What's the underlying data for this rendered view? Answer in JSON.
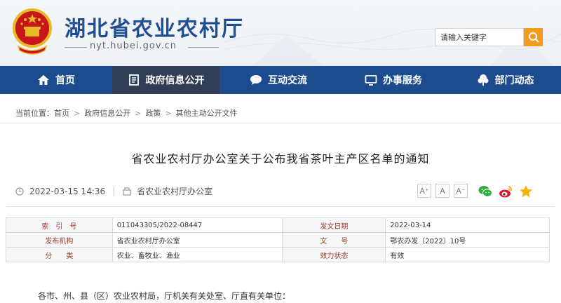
{
  "header": {
    "site_title": "湖北省农业农村厅",
    "site_url": "nyt.hubei.gov.cn",
    "search": {
      "placeholder": "请输入关键字"
    }
  },
  "nav": {
    "items": [
      {
        "label": "首页",
        "icon": "home-icon"
      },
      {
        "label": "政府信息公开",
        "icon": "document-icon",
        "active": true
      },
      {
        "label": "互动交流",
        "icon": "chat-icon"
      },
      {
        "label": "办事服务",
        "icon": "monitor-icon"
      },
      {
        "label": "部门动态",
        "icon": "tree-icon"
      }
    ]
  },
  "breadcrumb": {
    "prefix": "当前位置：",
    "items": [
      "首页",
      "政府信息公开",
      "政策",
      "其他主动公开文件"
    ],
    "separator": ">"
  },
  "article": {
    "title": "省农业农村厅办公室关于公布我省茶叶主产区名单的通知",
    "datetime": "2022-03-15 14:36",
    "source": "省农业农村厅办公室",
    "font_buttons": [
      "A⁺",
      "A",
      "A⁻"
    ],
    "share": [
      "wechat-icon",
      "weibo-icon",
      "star-icon"
    ],
    "intro": "各市、州、县（区）农业农村局，厅机关有关处室、厅直有关单位："
  },
  "info_table": [
    {
      "label1": "索　引　号",
      "value1": "011043305/2022-08447",
      "label2": "发文日期",
      "value2": "2022-03-14"
    },
    {
      "label1": "发布机构",
      "value1": "省农业农村厅办公室",
      "label2": "文　　号",
      "value2": "鄂农办发〔2022〕10号"
    },
    {
      "label1": "分　　类",
      "value1": "农业、畜牧业、渔业",
      "label2": "效力状态",
      "value2": "有效"
    }
  ],
  "colors": {
    "brand_blue": "#1c4c8e",
    "nav_active": "#2f3e55",
    "search_button": "#f29b1d",
    "table_label": "#9b3a2e"
  }
}
